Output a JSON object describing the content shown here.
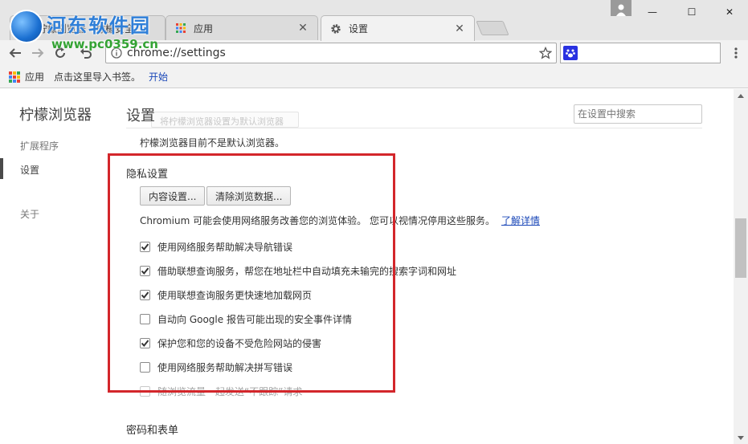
{
  "window": {
    "watermark_brand": "河东软件园",
    "watermark_url": "www.pc0359.cn",
    "minimize_glyph": "—",
    "maximize_glyph": "☐",
    "close_glyph": "✕"
  },
  "tabs": [
    {
      "title": "柠檬浏览器 - 柠檬安全",
      "icon": "lemon-icon",
      "active": false
    },
    {
      "title": "应用",
      "icon": "apps-icon",
      "active": false
    },
    {
      "title": "设置",
      "icon": "gear-icon",
      "active": true
    }
  ],
  "toolbar": {
    "address": "chrome://settings",
    "search_value": ""
  },
  "bookmarks": {
    "apps_label": "应用",
    "import_hint": "点击这里导入书签。",
    "start_label": "开始"
  },
  "sidebar": {
    "title": "柠檬浏览器",
    "items": [
      {
        "label": "扩展程序",
        "active": false
      },
      {
        "label": "设置",
        "active": true
      },
      {
        "label": "关于",
        "active": false
      }
    ]
  },
  "main": {
    "title": "设置",
    "search_placeholder": "在设置中搜索",
    "default_browser_button": "将柠檬浏览器设置为默认浏览器",
    "default_browser_text": "柠檬浏览器目前不是默认浏览器。",
    "privacy": {
      "title": "隐私设置",
      "content_settings_button": "内容设置...",
      "clear_data_button": "清除浏览数据...",
      "description": "Chromium 可能会使用网络服务改善您的浏览体验。 您可以视情况停用这些服务。",
      "learn_more": "了解详情",
      "options": [
        {
          "label": "使用网络服务帮助解决导航错误",
          "checked": true
        },
        {
          "label": "借助联想查询服务，帮您在地址栏中自动填充未输完的搜索字词和网址",
          "checked": true
        },
        {
          "label": "使用联想查询服务更快速地加载网页",
          "checked": true
        },
        {
          "label": "自动向 Google 报告可能出现的安全事件详情",
          "checked": false
        },
        {
          "label": "保护您和您的设备不受危险网站的侵害",
          "checked": true
        },
        {
          "label": "使用网络服务帮助解决拼写错误",
          "checked": false
        },
        {
          "label": "随浏览流量一起发送“不跟踪”请求",
          "checked": false
        }
      ]
    },
    "passwords_title": "密码和表单"
  },
  "colors": {
    "highlight_border": "#d3262b",
    "link": "#1a47b8",
    "checkbox_check": "#333333"
  }
}
